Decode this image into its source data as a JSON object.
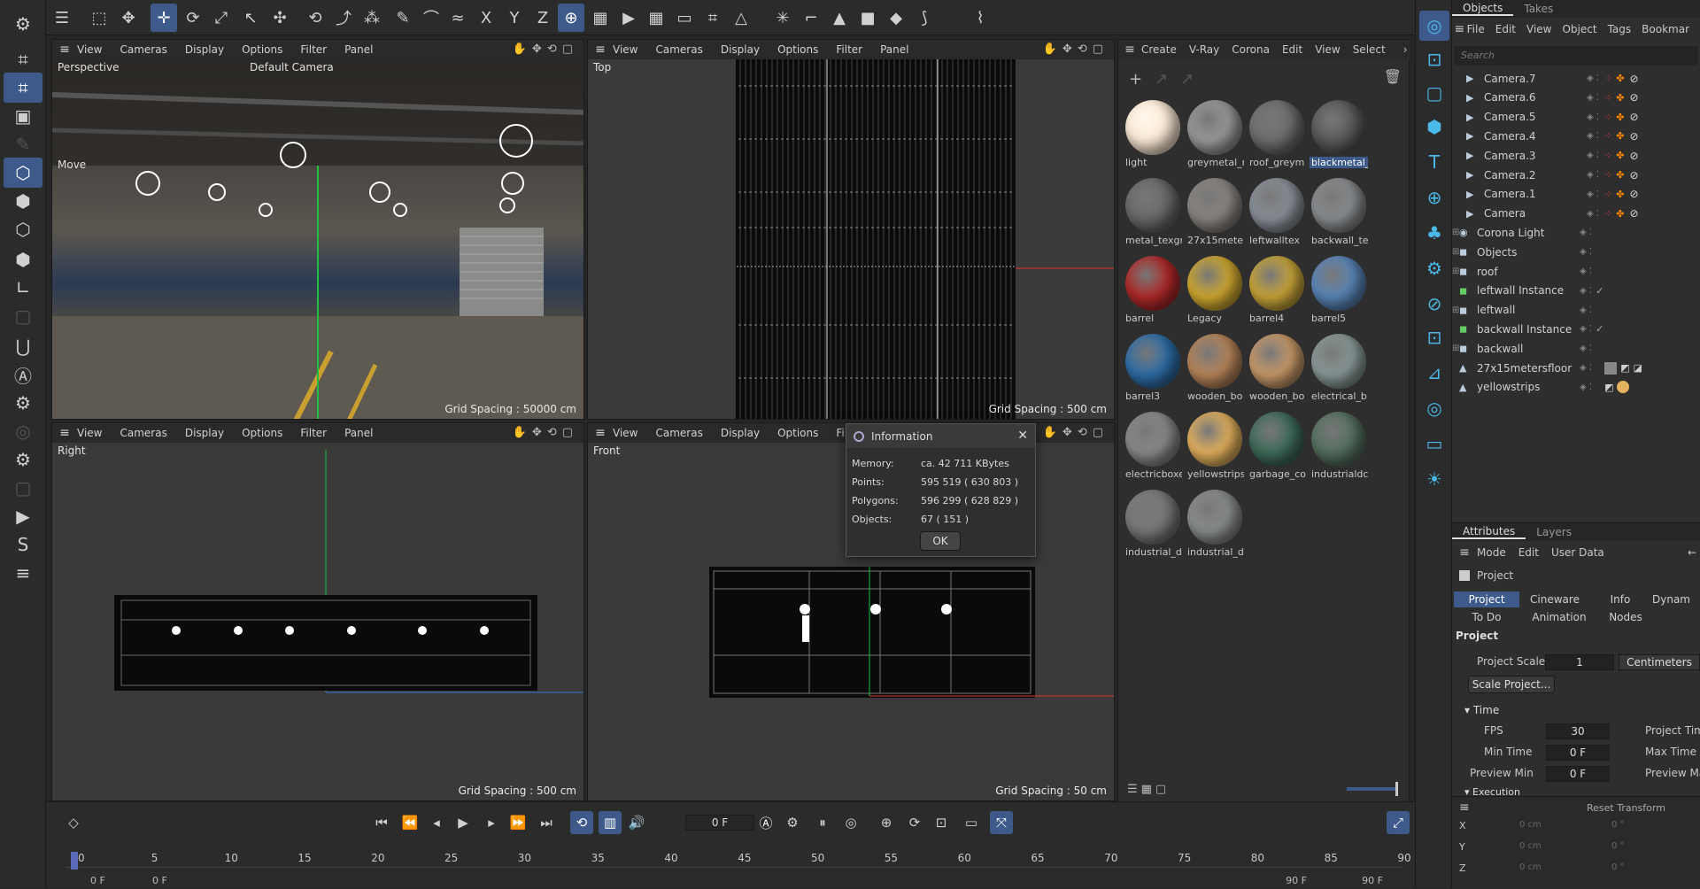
{
  "top_tools": [
    "☰",
    "⬚",
    "✥",
    "✛",
    "⟳",
    "⤢",
    "↖",
    "✣",
    "⟲",
    "⤴",
    "⁂",
    "✎",
    "⌒",
    "≈",
    "X",
    "Y",
    "Z",
    "⊕",
    "▦",
    "▶",
    "▦",
    "▭",
    "⌗",
    "△",
    "✳",
    "⌐",
    "▲",
    "■",
    "◆",
    "⟆",
    "⌇"
  ],
  "left_tools": [
    "⚙",
    "⌗",
    "⌗",
    "▣",
    "✎",
    "⬡",
    "⬢",
    "⬡",
    "⬢",
    "∟",
    "▢",
    "⋃",
    "Ⓐ",
    "⚙",
    "◎",
    "⚙",
    "▢",
    "▶",
    "S",
    "≡"
  ],
  "viewports": {
    "menus": [
      "View",
      "Cameras",
      "Display",
      "Options",
      "Filter",
      "Panel"
    ],
    "perspective": {
      "label": "Perspective",
      "camera": "Default Camera",
      "move": "Move",
      "grid": "Grid Spacing : 50000 cm"
    },
    "top": {
      "label": "Top",
      "grid": "Grid Spacing : 500 cm"
    },
    "right": {
      "label": "Right",
      "grid": "Grid Spacing : 500 cm"
    },
    "front": {
      "label": "Front",
      "grid": "Grid Spacing : 50 cm"
    }
  },
  "materials": {
    "menus": [
      "Create",
      "V-Ray",
      "Corona",
      "Edit",
      "View",
      "Select"
    ],
    "items": [
      {
        "name": "light",
        "color": "#fbe9d4"
      },
      {
        "name": "greymetal_r",
        "color": "#9a9a9a"
      },
      {
        "name": "roof_greym",
        "color": "#6e6e70"
      },
      {
        "name": "blackmetal_",
        "color": "#5a5a5c"
      },
      {
        "name": "metal_texgr",
        "color": "#6a6a6a"
      },
      {
        "name": "27x15meter",
        "color": "#8a8580"
      },
      {
        "name": "leftwalltex",
        "color": "#8a9098"
      },
      {
        "name": "backwall_te",
        "color": "#8a8d90"
      },
      {
        "name": "barrel",
        "color": "#b02a2a"
      },
      {
        "name": "Legacy",
        "color": "#d0a930"
      },
      {
        "name": "barrel4",
        "color": "#c9a63a"
      },
      {
        "name": "barrel5",
        "color": "#5a86b8"
      },
      {
        "name": "barrel3",
        "color": "#2f6fa8"
      },
      {
        "name": "wooden_bo",
        "color": "#b8865a"
      },
      {
        "name": "wooden_bo",
        "color": "#c99a6a"
      },
      {
        "name": "electrical_b",
        "color": "#8a9a98"
      },
      {
        "name": "electricboxe",
        "color": "#8a8a8a"
      },
      {
        "name": "yellowstrips",
        "color": "#e4b25e"
      },
      {
        "name": "garbage_co",
        "color": "#3f6c5a"
      },
      {
        "name": "industrialdc",
        "color": "#557060"
      },
      {
        "name": "industrial_d",
        "color": "#7a7a7a"
      },
      {
        "name": "industrial_d",
        "color": "#8a8e8c"
      }
    ]
  },
  "objects": {
    "tabs": [
      "Objects",
      "Takes"
    ],
    "menus": [
      "File",
      "Edit",
      "View",
      "Object",
      "Tags",
      "Bookmar"
    ],
    "search_placeholder": "Search",
    "rows": [
      "Camera.7",
      "Camera.6",
      "Camera.5",
      "Camera.4",
      "Camera.3",
      "Camera.2",
      "Camera.1",
      "Camera",
      "Corona Light",
      "Objects",
      "roof",
      "leftwall Instance",
      "leftwall",
      "backwall Instance",
      "backwall",
      "27x15metersfloor",
      "yellowstrips"
    ]
  },
  "attributes": {
    "tabs": [
      "Attributes",
      "Layers"
    ],
    "menus": [
      "Mode",
      "Edit",
      "User Data"
    ],
    "title": "Project",
    "subtabs": [
      "Project",
      "Cineware",
      "Info",
      "Dynam"
    ],
    "subtabs2": [
      "To Do",
      "Animation",
      "Nodes"
    ],
    "section": "Project",
    "scale_label": "Project Scale",
    "scale_value": "1",
    "scale_unit": "Centimeters",
    "scale_btn": "Scale Project...",
    "time_section": "Time",
    "fps_label": "FPS",
    "fps_value": "30",
    "project_time": "Project Time",
    "min_label": "Min Time",
    "min_value": "0 F",
    "max_label": "Max Time",
    "pmin_label": "Preview Min",
    "pmin_value": "0 F",
    "pmax_label": "Preview Ma",
    "exec_section": "Execution",
    "reset": "Reset Transform",
    "coords": [
      {
        "axis": "X",
        "pos": "0 cm",
        "rot": "0 °"
      },
      {
        "axis": "Y",
        "pos": "0 cm",
        "rot": "0 °"
      },
      {
        "axis": "Z",
        "pos": "0 cm",
        "rot": "0 °"
      }
    ]
  },
  "timeline": {
    "frame": "0 F",
    "ticks": [
      "0",
      "5",
      "10",
      "15",
      "20",
      "25",
      "30",
      "35",
      "40",
      "45",
      "50",
      "55",
      "60",
      "65",
      "70",
      "75",
      "80",
      "85",
      "90"
    ],
    "start": "0 F",
    "start2": "0 F",
    "end": "90 F",
    "end2": "90 F"
  },
  "dialog": {
    "title": "Information",
    "rows": [
      {
        "k": "Memory:",
        "v": "ca. 42 711 KBytes"
      },
      {
        "k": "Points:",
        "v": "595 519 ( 630 803 )"
      },
      {
        "k": "Polygons:",
        "v": "596 299 ( 628 829 )"
      },
      {
        "k": "Objects:",
        "v": "67 ( 151 )"
      }
    ],
    "ok": "OK"
  }
}
